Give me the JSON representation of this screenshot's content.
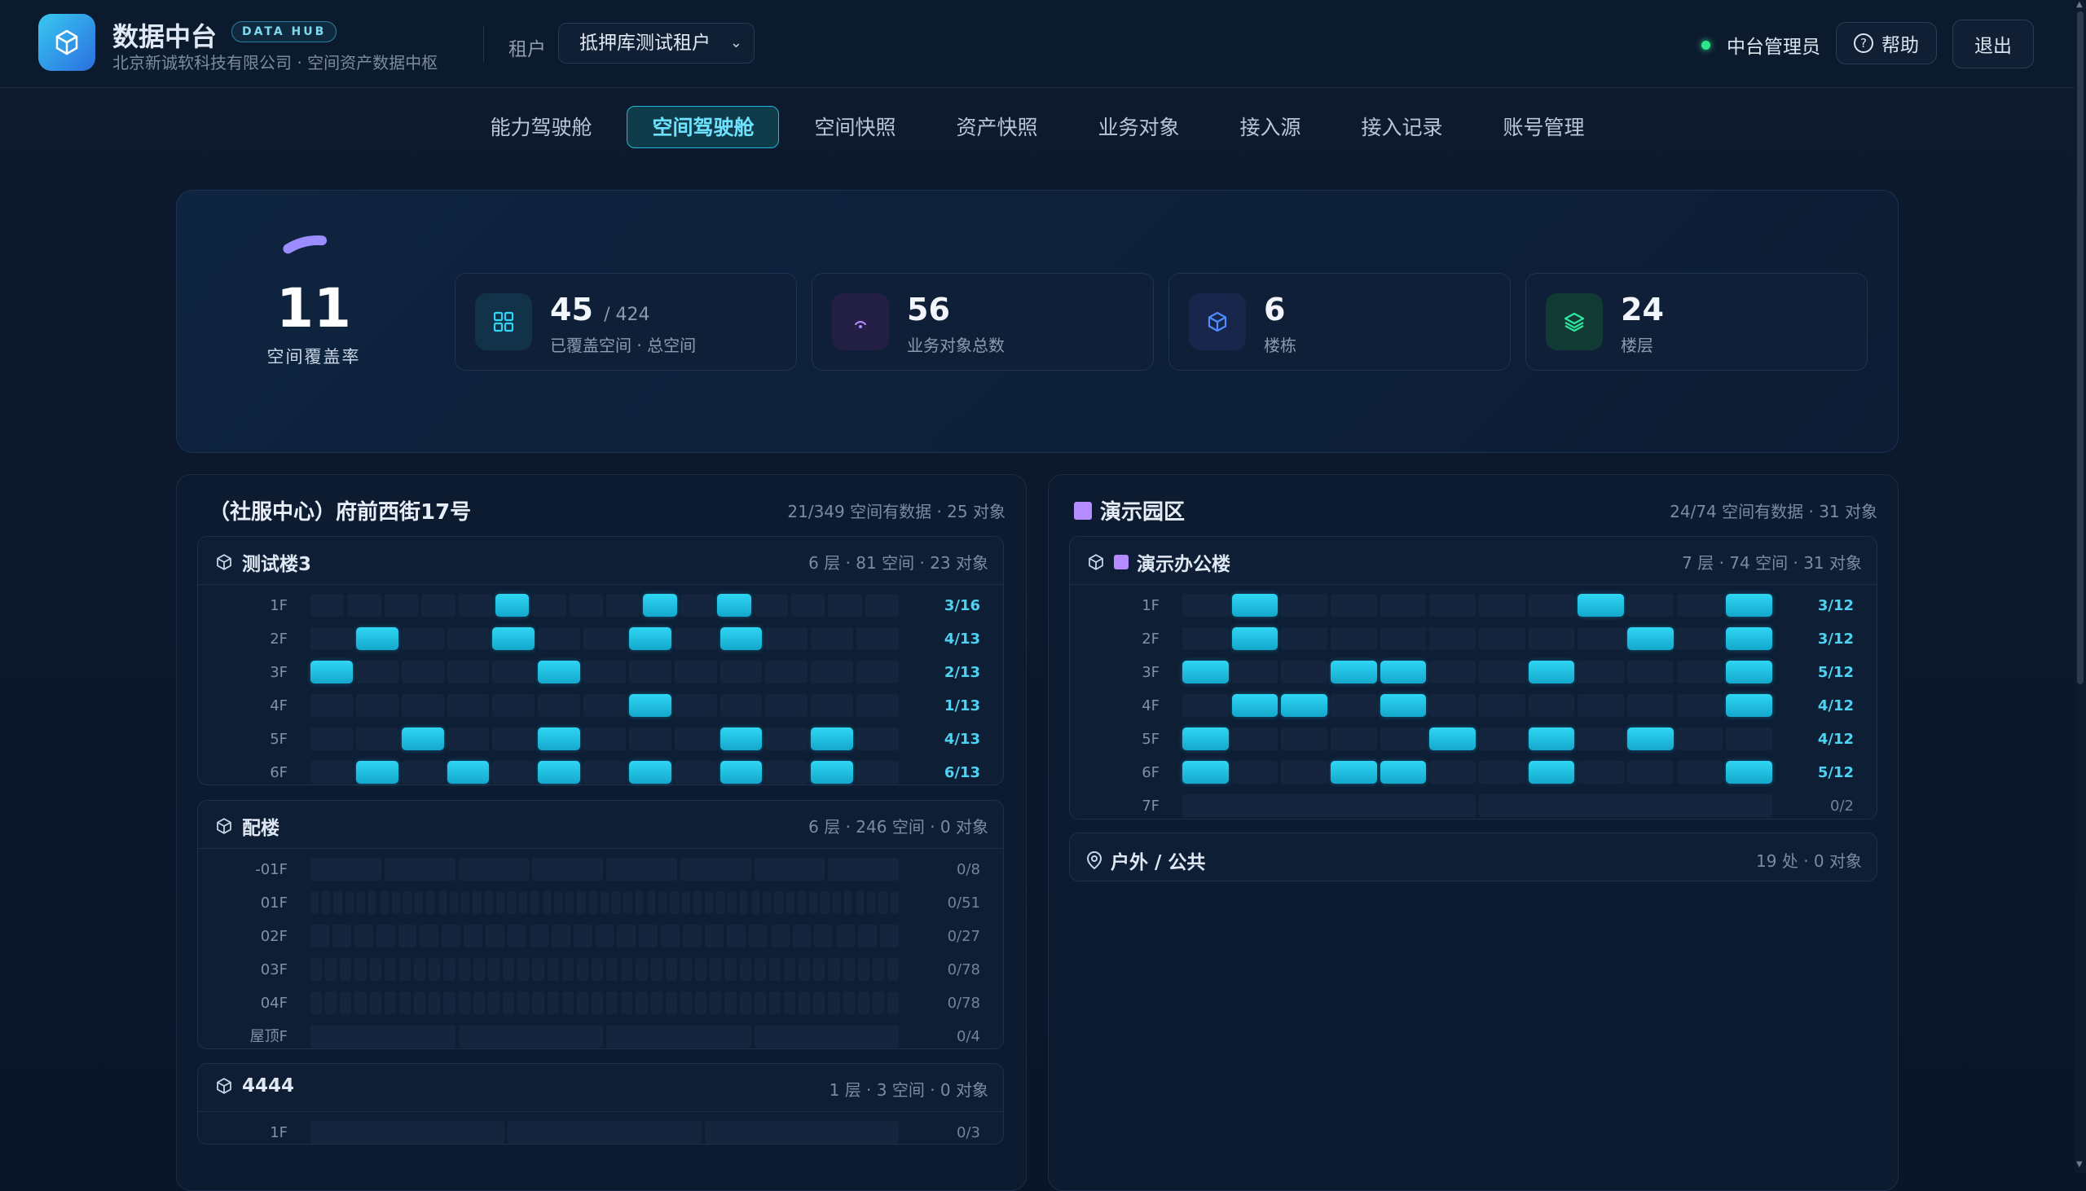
{
  "header": {
    "brand": "数据中台",
    "badge": "DATA HUB",
    "company": "北京新诚软科技有限公司 · 空间资产数据中枢",
    "tenant_label": "租户",
    "tenant_value": "抵押库测试租户",
    "user": "中台管理员",
    "help": "帮助",
    "logout": "退出"
  },
  "nav": [
    {
      "label": "能力驾驶舱",
      "active": false
    },
    {
      "label": "空间驾驶舱",
      "active": true
    },
    {
      "label": "空间快照",
      "active": false
    },
    {
      "label": "资产快照",
      "active": false
    },
    {
      "label": "业务对象",
      "active": false
    },
    {
      "label": "接入源",
      "active": false
    },
    {
      "label": "接入记录",
      "active": false
    },
    {
      "label": "账号管理",
      "active": false
    }
  ],
  "overview": {
    "coverage_value": "11",
    "coverage_label": "空间覆盖率",
    "coverage_fraction": 0.11,
    "stats": [
      {
        "num": "45",
        "sub": "/ 424",
        "caption": "已覆盖空间 · 总空间",
        "icon": "grid-icon",
        "color": "#2fd6f4"
      },
      {
        "num": "56",
        "sub": "",
        "caption": "业务对象总数",
        "icon": "wifi-icon",
        "color": "#b388ff"
      },
      {
        "num": "6",
        "sub": "",
        "caption": "楼栋",
        "icon": "cube-icon",
        "color": "#4f8dff"
      },
      {
        "num": "24",
        "sub": "",
        "caption": "楼层",
        "icon": "layers-icon",
        "color": "#2ee6a0"
      }
    ]
  },
  "left_panel": {
    "title": "（社服中心）府前西街17号",
    "meta": "21/349 空间有数据 · 25 对象",
    "buildings": [
      {
        "name": "测试楼3",
        "meta": "6 层 · 81 空间 · 23 对象",
        "floors": [
          {
            "label": "1F",
            "count": "3/16",
            "cells": 16,
            "on": [
              5,
              9,
              11
            ]
          },
          {
            "label": "2F",
            "count": "4/13",
            "cells": 13,
            "on": [
              1,
              4,
              7,
              9
            ]
          },
          {
            "label": "3F",
            "count": "2/13",
            "cells": 13,
            "on": [
              0,
              5
            ]
          },
          {
            "label": "4F",
            "count": "1/13",
            "cells": 13,
            "on": [
              7
            ]
          },
          {
            "label": "5F",
            "count": "4/13",
            "cells": 13,
            "on": [
              2,
              5,
              9,
              11
            ]
          },
          {
            "label": "6F",
            "count": "6/13",
            "cells": 13,
            "on": [
              1,
              3,
              5,
              7,
              9,
              11
            ]
          }
        ]
      },
      {
        "name": "配楼",
        "meta": "6 层 · 246 空间 · 0 对象",
        "floors": [
          {
            "label": "-01F",
            "count": "0/8",
            "cells": 8,
            "on": []
          },
          {
            "label": "01F",
            "count": "0/51",
            "cells": 51,
            "on": []
          },
          {
            "label": "02F",
            "count": "0/27",
            "cells": 27,
            "on": []
          },
          {
            "label": "03F",
            "count": "0/78",
            "cells": 40,
            "on": []
          },
          {
            "label": "04F",
            "count": "0/78",
            "cells": 40,
            "on": []
          },
          {
            "label": "屋顶F",
            "count": "0/4",
            "cells": 4,
            "on": []
          }
        ]
      },
      {
        "name": "4444",
        "meta": "1 层 · 3 空间 · 0 对象",
        "floors": [
          {
            "label": "1F",
            "count": "0/3",
            "cells": 3,
            "on": []
          }
        ]
      }
    ]
  },
  "right_panel": {
    "title": "演示园区",
    "meta": "24/74 空间有数据 · 31 对象",
    "buildings": [
      {
        "name": "演示办公楼",
        "meta": "7 层 · 74 空间 · 31 对象",
        "floors": [
          {
            "label": "1F",
            "count": "3/12",
            "cells": 12,
            "on": [
              1,
              8,
              11
            ]
          },
          {
            "label": "2F",
            "count": "3/12",
            "cells": 12,
            "on": [
              1,
              9,
              11
            ]
          },
          {
            "label": "3F",
            "count": "5/12",
            "cells": 12,
            "on": [
              0,
              3,
              4,
              7,
              11
            ]
          },
          {
            "label": "4F",
            "count": "4/12",
            "cells": 12,
            "on": [
              1,
              2,
              4,
              11
            ]
          },
          {
            "label": "5F",
            "count": "4/12",
            "cells": 12,
            "on": [
              0,
              5,
              7,
              9
            ]
          },
          {
            "label": "6F",
            "count": "5/12",
            "cells": 12,
            "on": [
              0,
              3,
              4,
              7,
              11
            ]
          },
          {
            "label": "7F",
            "count": "0/2",
            "cells": 2,
            "on": []
          }
        ]
      }
    ],
    "outdoor": {
      "name": "户外 / 公共",
      "meta": "19 处 · 0 对象"
    }
  }
}
